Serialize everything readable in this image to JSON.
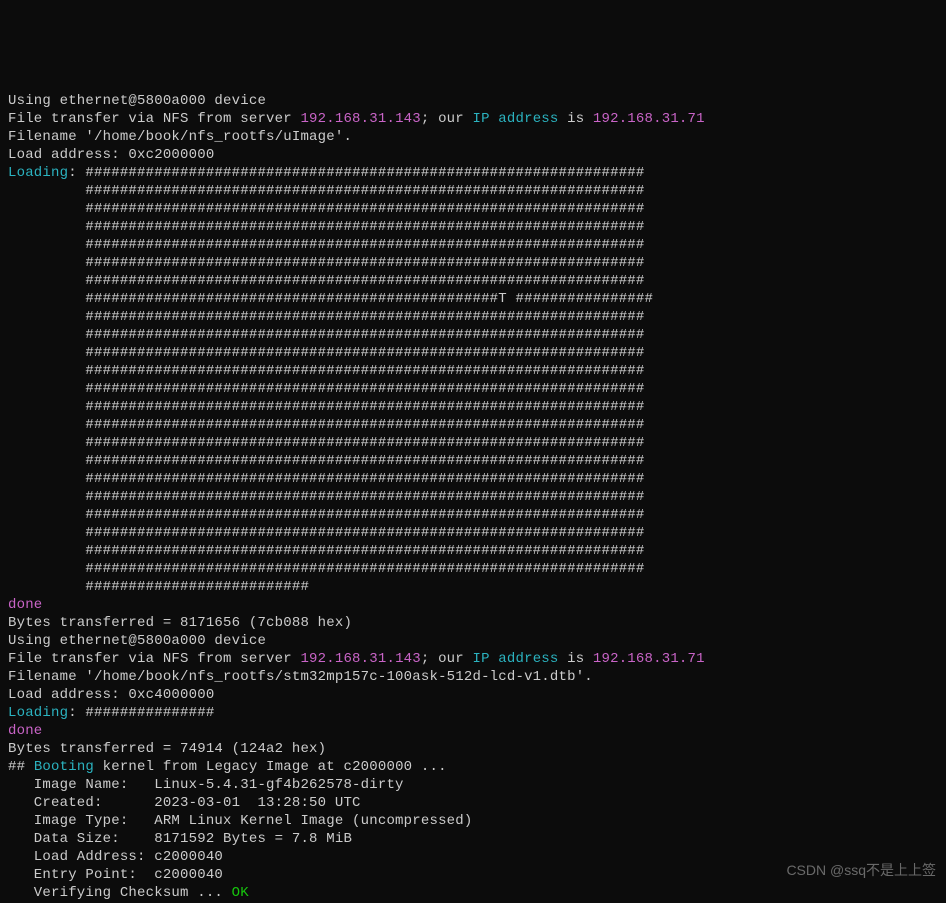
{
  "net1": {
    "using_device": "Using ethernet@5800a000 device",
    "xfer_pre": "File transfer via NFS from server ",
    "server_ip": "192.168.31.143",
    "xfer_mid": "; our ",
    "ip_label": "IP address",
    "xfer_post": " is ",
    "our_ip": "192.168.31.71",
    "filename": "Filename '/home/book/nfs_rootfs/uImage'.",
    "load_addr": "Load address: 0xc2000000",
    "loading_label": "Loading",
    "colon_space": ": ",
    "hash_first": "#################################################################",
    "hash_full": "#################################################################",
    "hash_full_count": 6,
    "hash_t": "################################################T ################",
    "hash_post_t": "#################################################################",
    "hash_post_t_count": 14,
    "hash_short_line": "#################################################################",
    "hash_last": "##########################",
    "indent": "         ",
    "done": "done",
    "bytes_xfer": "Bytes transferred = 8171656 (7cb088 hex)"
  },
  "net2": {
    "using_device": "Using ethernet@5800a000 device",
    "xfer_pre": "File transfer via NFS from server ",
    "server_ip": "192.168.31.143",
    "xfer_mid": "; our ",
    "ip_label": "IP address",
    "xfer_post": " is ",
    "our_ip": "192.168.31.71",
    "filename": "Filename '/home/book/nfs_rootfs/stm32mp157c-100ask-512d-lcd-v1.dtb'.",
    "load_addr": "Load address: 0xc4000000",
    "loading_label": "Loading",
    "colon_space": ": ",
    "hash_line": "###############",
    "done": "done",
    "bytes_xfer": "Bytes transferred = 74914 (124a2 hex)"
  },
  "boot": {
    "hh_pre": "## ",
    "booting_word": "Booting",
    "hh_rest": " kernel from Legacy Image at c2000000 ...",
    "image_name": "   Image Name:   Linux-5.4.31-gf4b262578-dirty",
    "created": "   Created:      2023-03-01  13:28:50 UTC",
    "image_type": "   Image Type:   ARM Linux Kernel Image (uncompressed)",
    "data_size": "   Data Size:    8171592 Bytes = 7.8 MiB",
    "load_address": "   Load Address: c2000040",
    "entry_point": "   Entry Point:  c2000040",
    "verify_pre": "   Verifying Checksum ... ",
    "ok": "OK"
  },
  "watermark": "CSDN @ssq不是上上签"
}
